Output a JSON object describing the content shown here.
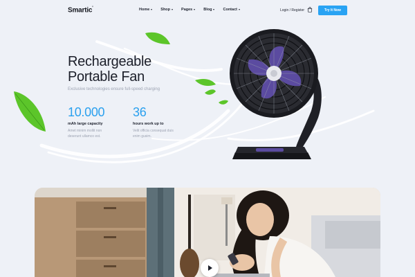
{
  "brand": {
    "name": "Smartic",
    "mark": "'"
  },
  "nav": {
    "items": [
      {
        "label": "Home"
      },
      {
        "label": "Shop"
      },
      {
        "label": "Pages"
      },
      {
        "label": "Blog"
      },
      {
        "label": "Contact"
      }
    ],
    "login_label": "Login / Register",
    "cta_label": "Try It Now",
    "cart_icon": "shopping-bag-icon"
  },
  "hero": {
    "title_line1": "Rechargeable",
    "title_line2": "Portable Fan",
    "subtitle": "Exclusive technologies ensure full-speed charging",
    "stats": [
      {
        "value": "10.000",
        "label": "mAh large capacity",
        "desc": "Amet minim mollit non deserunt ullamco est."
      },
      {
        "value": "36",
        "label": "hours work up to",
        "desc": "Velit officia consequat duis enim gusim."
      }
    ]
  },
  "colors": {
    "accent": "#29a3f3",
    "leaf": "#5cc52a",
    "fan_body": "#1a1b20",
    "fan_blade": "#5b4ba0"
  },
  "video": {
    "play_icon": "play-icon"
  }
}
